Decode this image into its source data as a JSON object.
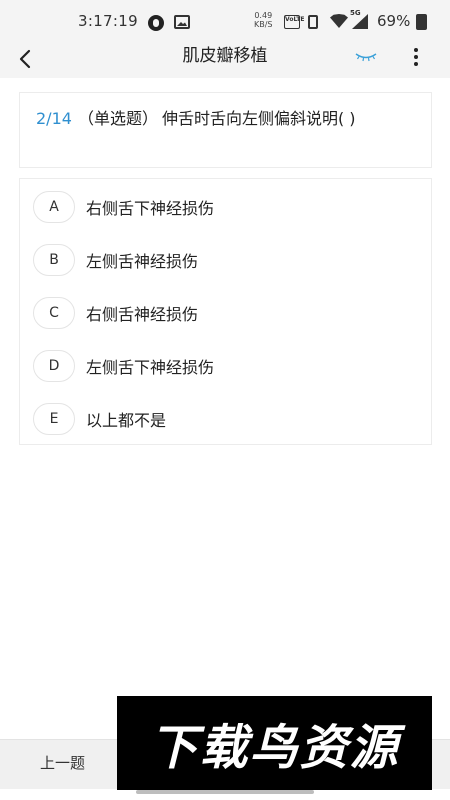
{
  "status_bar": {
    "time": "3:17:19",
    "net_speed_value": "0.49",
    "net_speed_unit": "KB/S",
    "volte_label": "VoLTE",
    "network_label": "5G",
    "battery_percent": "69%"
  },
  "header": {
    "title": "肌皮瓣移植"
  },
  "question": {
    "counter": "2/14",
    "type": "（单选题）",
    "text": "伸舌时舌向左侧偏斜说明( )"
  },
  "options": [
    {
      "letter": "A",
      "text": "右侧舌下神经损伤"
    },
    {
      "letter": "B",
      "text": "左侧舌神经损伤"
    },
    {
      "letter": "C",
      "text": "右侧舌神经损伤"
    },
    {
      "letter": "D",
      "text": "左侧舌下神经损伤"
    },
    {
      "letter": "E",
      "text": "以上都不是"
    }
  ],
  "footer": {
    "prev_label": "上一题"
  },
  "watermark": {
    "text": "下载鸟资源"
  },
  "colors": {
    "accent": "#2f8fd0"
  }
}
